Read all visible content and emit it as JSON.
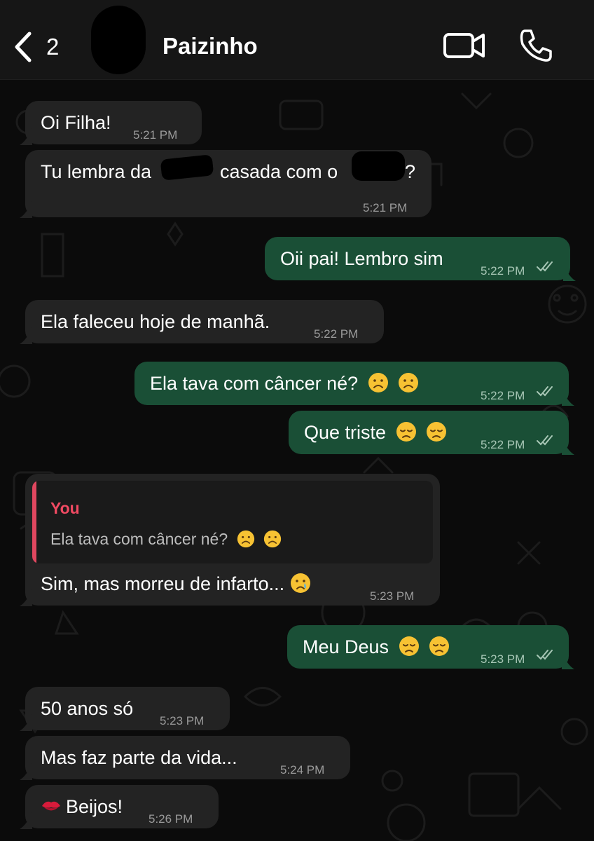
{
  "header": {
    "back_count": "2",
    "contact_name": "Paizinho"
  },
  "icons": {
    "back": "chevron-left-icon",
    "video": "video-camera-icon",
    "phone": "phone-icon",
    "read_receipt": "double-check-icon"
  },
  "colors": {
    "incoming_bubble": "#232323",
    "outgoing_bubble": "#1a4f36",
    "quote_accent": "#e0475f",
    "background": "#0b0b0b"
  },
  "messages": [
    {
      "direction": "in",
      "text": "Oi Filha!",
      "time": "5:21 PM"
    },
    {
      "direction": "in",
      "text_start": "Tu lembra da",
      "text_middle": "casada com o",
      "text_end": "?",
      "time": "5:21 PM"
    },
    {
      "direction": "out",
      "text": "Oii pai! Lembro sim",
      "time": "5:22 PM",
      "status": "read"
    },
    {
      "direction": "in",
      "text": "Ela faleceu hoje de manhã.",
      "time": "5:22 PM"
    },
    {
      "direction": "out",
      "text": "Ela tava com câncer né?",
      "emoji": "frowning-face-emoji x2",
      "time": "5:22 PM",
      "status": "read"
    },
    {
      "direction": "out",
      "text": "Que triste",
      "emoji": "disappointed-face-emoji x2",
      "time": "5:22 PM",
      "status": "read"
    },
    {
      "direction": "in",
      "quote_author": "You",
      "quote_text": "Ela tava com câncer né?",
      "text": "Sim, mas morreu de infarto...",
      "emoji": "crying-face-emoji",
      "time": "5:23 PM"
    },
    {
      "direction": "out",
      "text": "Meu Deus",
      "emoji": "disappointed-face-emoji x2",
      "time": "5:23 PM",
      "status": "read"
    },
    {
      "direction": "in",
      "text": "50 anos só",
      "time": "5:23 PM"
    },
    {
      "direction": "in",
      "text": "Mas faz parte da vida...",
      "time": "5:24 PM"
    },
    {
      "direction": "in",
      "text": "Beijos!",
      "emoji": "kiss-mark-emoji",
      "time": "5:26 PM"
    }
  ]
}
